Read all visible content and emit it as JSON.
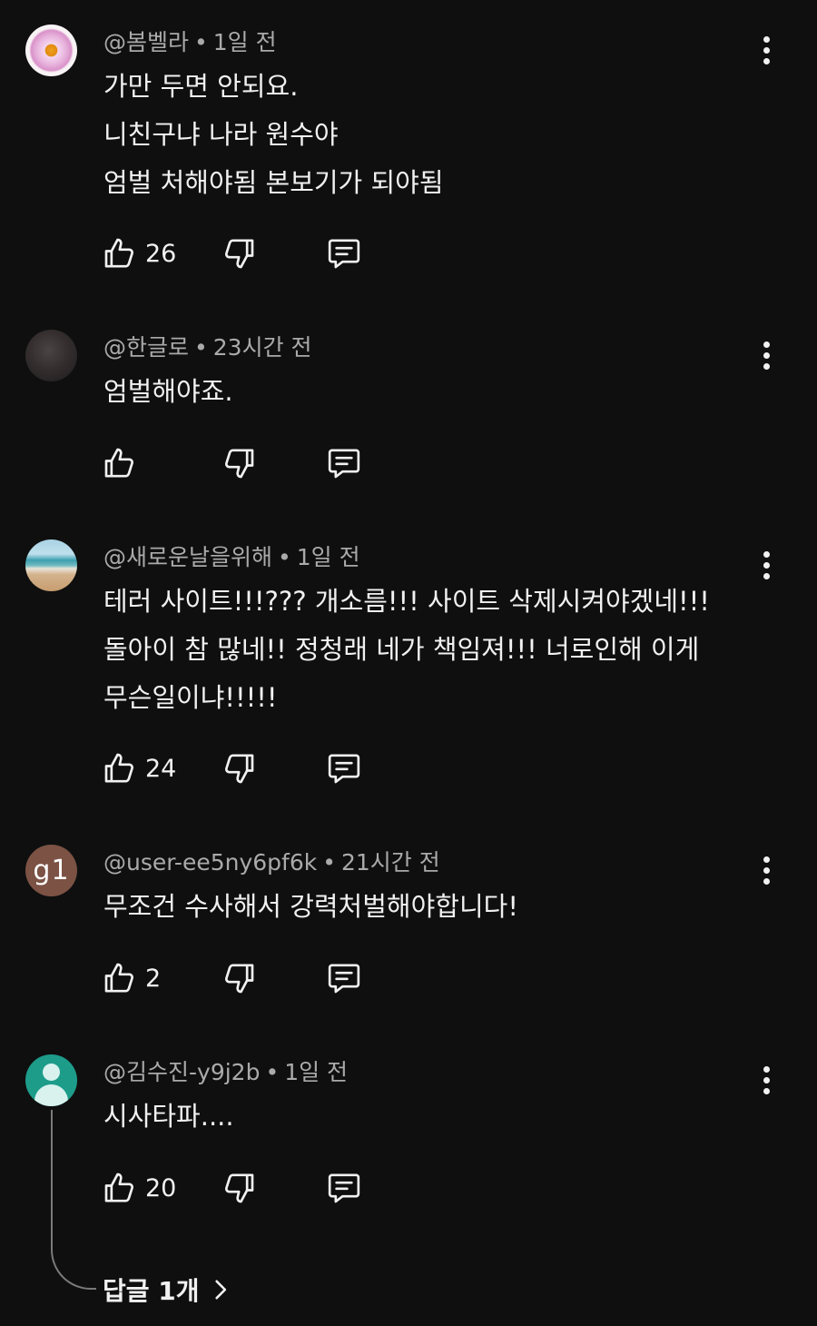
{
  "comments": [
    {
      "author": "@봄벨라",
      "time": "1일 전",
      "avatar": "flower-avatar",
      "lines": [
        "가만 두면 안되요.",
        "니친구냐 나라 원수야",
        "엄벌 처해야됨 본보기가 되야됨"
      ],
      "likes": "26"
    },
    {
      "author": "@한글로",
      "time": "23시간 전",
      "avatar": "dark-avatar",
      "lines": [
        "엄벌해야죠."
      ],
      "likes": ""
    },
    {
      "author": "@새로운날을위해",
      "time": "1일 전",
      "avatar": "beach-avatar",
      "lines": [
        "테러 사이트!!!??? 개소름!!! 사이트 삭제시켜야겠네!!!",
        "돌아이 참 많네!! 정청래 네가 책임져!!! 너로인해 이게",
        "무슨일이냐!!!!!"
      ],
      "likes": "24"
    },
    {
      "author": "@user-ee5ny6pf6k",
      "time": "21시간 전",
      "avatar": "letter-avatar",
      "avatar_text": "g1",
      "lines": [
        "무조건 수사해서 강력처벌해야합니다!"
      ],
      "likes": "2"
    },
    {
      "author": "@김수진-y9j2b",
      "time": "1일 전",
      "avatar": "person-avatar",
      "lines": [
        "시사타파...."
      ],
      "likes": "20"
    }
  ],
  "separator": "•",
  "replies_label": "답글 1개",
  "icons": {
    "like": "thumb-up-icon",
    "dislike": "thumb-down-icon",
    "reply": "reply-comment-icon",
    "menu": "more-vertical-icon",
    "chevron": "chevron-right-icon"
  },
  "colors": {
    "background": "#0f0f0f",
    "text": "#f1f1f1",
    "meta": "#aaaaaa"
  }
}
